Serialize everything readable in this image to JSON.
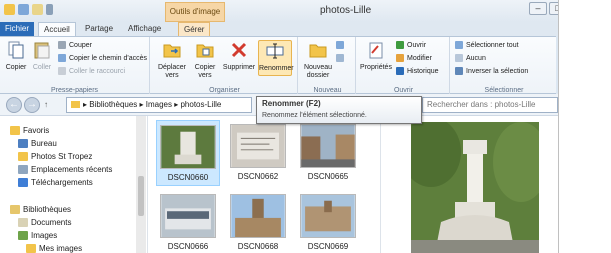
{
  "window": {
    "title": "photos-Lille",
    "context_group": "Outils d'image"
  },
  "tabs": [
    "Fichier",
    "Accueil",
    "Partage",
    "Affichage",
    "Gérer"
  ],
  "ribbon": {
    "presse_papiers": {
      "label": "Presse-papiers",
      "copier": "Copier",
      "coller": "Coller",
      "couper": "Couper",
      "copier_chemin": "Copier le chemin d'accès",
      "coller_raccourci": "Coller le raccourci"
    },
    "organiser": {
      "label": "Organiser",
      "deplacer": "Déplacer vers",
      "copier_vers": "Copier vers",
      "supprimer": "Supprimer",
      "renommer": "Renommer"
    },
    "nouveau": {
      "label": "Nouveau",
      "nouveau_dossier": "Nouveau dossier"
    },
    "ouvrir": {
      "label": "Ouvrir",
      "proprietes": "Propriétés",
      "ouvrir": "Ouvrir",
      "modifier": "Modifier",
      "historique": "Historique"
    },
    "selectionner": {
      "label": "Sélectionner",
      "tout": "Sélectionner tout",
      "aucun": "Aucun",
      "inverser": "Inverser la sélection"
    }
  },
  "address": {
    "path": [
      "Bibliothèques",
      "Images",
      "photos-Lille"
    ]
  },
  "search": {
    "placeholder": "Rechercher dans : photos-Lille"
  },
  "tooltip": {
    "title": "Renommer (F2)",
    "body": "Renommez l'élément sélectionné."
  },
  "nav": {
    "favoris": "Favoris",
    "favoris_items": [
      "Bureau",
      "Photos St Tropez",
      "Emplacements récents",
      "Téléchargements"
    ],
    "bibliotheques": "Bibliothèques",
    "bib_items": [
      "Documents",
      "Images",
      "Mes images"
    ]
  },
  "files": [
    {
      "name": "DSCN0660",
      "selected": true
    },
    {
      "name": "DSCN0662",
      "selected": false
    },
    {
      "name": "DSCN0665",
      "selected": false
    },
    {
      "name": "DSCN0666",
      "selected": false
    },
    {
      "name": "DSCN0668",
      "selected": false
    },
    {
      "name": "DSCN0669",
      "selected": false
    }
  ],
  "colors": {
    "accent": "#2b6cb8",
    "context_tab": "#fbe7c8",
    "selection": "#cce8ff",
    "close": "#c9463d"
  }
}
